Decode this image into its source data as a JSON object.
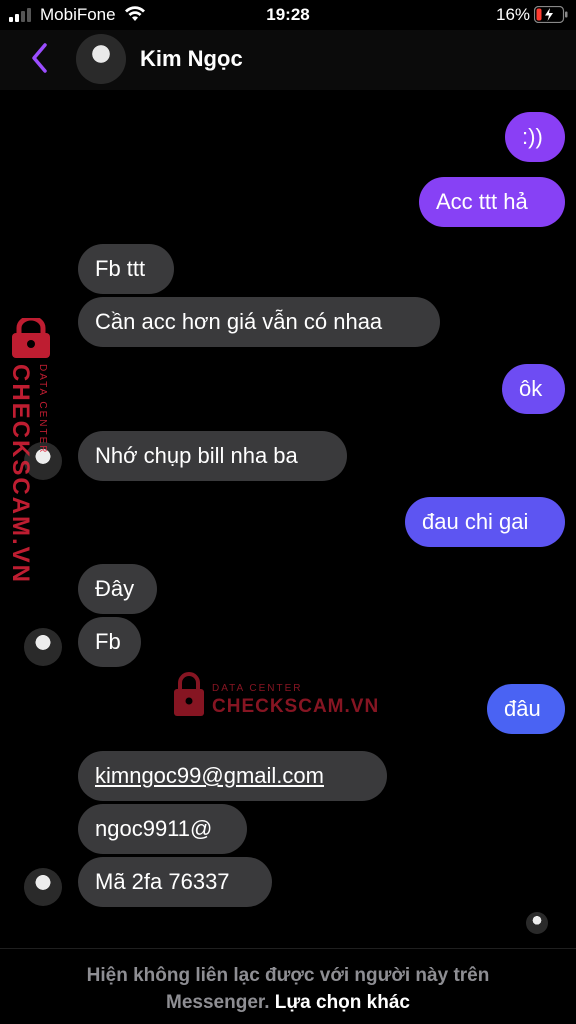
{
  "status_bar": {
    "carrier": "MobiFone",
    "time": "19:28",
    "battery": "16%"
  },
  "header": {
    "contact_name": "Kim Ngọc"
  },
  "messages": [
    {
      "side": "out",
      "text": ":))",
      "color": "#8a3ff5"
    },
    {
      "side": "out",
      "text": "Acc ttt hả",
      "color": "#8741f5"
    },
    {
      "side": "in",
      "text": "Fb ttt"
    },
    {
      "side": "in",
      "text": "Cần acc hơn giá vẫn có nhaa"
    },
    {
      "side": "out",
      "text": "ôk",
      "color": "#6e4cf3"
    },
    {
      "side": "in",
      "text": "Nhớ chụp bill nha ba"
    },
    {
      "side": "out",
      "text": "đau chi gai",
      "color": "#5d55f2"
    },
    {
      "side": "in",
      "text": "Đây"
    },
    {
      "side": "in",
      "text": "Fb"
    },
    {
      "side": "out",
      "text": "đâu",
      "color": "#4a63f3"
    },
    {
      "side": "in",
      "text": "kimngoc99@gmail.com",
      "link": true
    },
    {
      "side": "in",
      "text": "ngoc9911@"
    },
    {
      "side": "in",
      "text": "Mã 2fa 76337"
    }
  ],
  "watermark": {
    "brand": "CHECKSCAM.VN",
    "tag": "DATA CENTER",
    "color": "#e0233a"
  },
  "footer": {
    "notice": "Hiện không liên lạc được với người này trên Messenger.",
    "action": "Lựa chọn khác"
  },
  "icons": [
    "signal-icon",
    "wifi-icon",
    "battery-icon",
    "back-chevron-icon",
    "lock-icon"
  ]
}
